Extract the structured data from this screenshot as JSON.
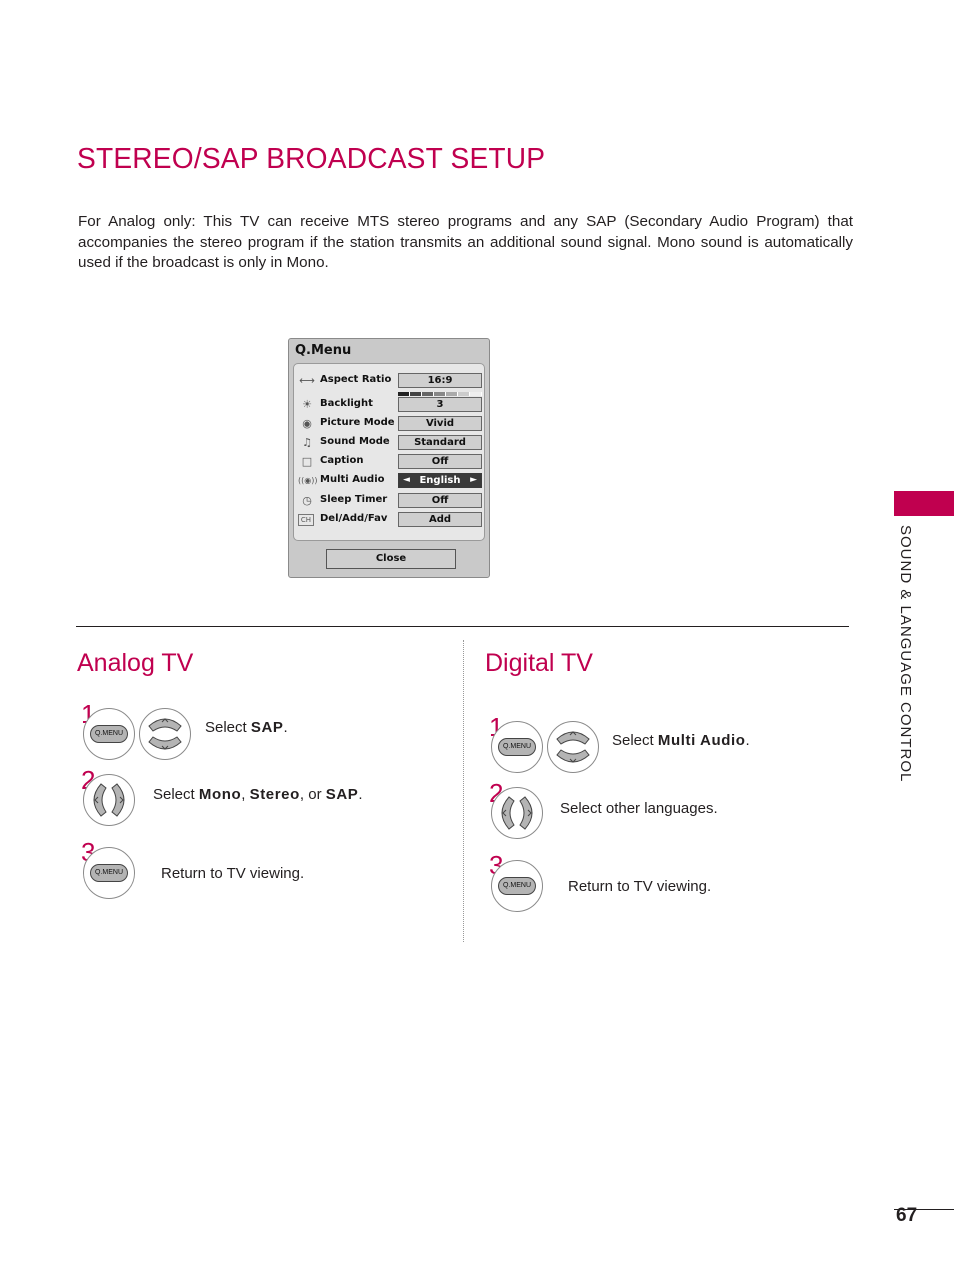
{
  "page": {
    "title": "STEREO/SAP BROADCAST SETUP",
    "intro": "For Analog only: This TV can receive MTS stereo programs and any SAP (Secondary Audio Program) that accompanies the stereo program if the station transmits an additional sound signal. Mono sound is automatically used if the broadcast is only in Mono.",
    "side_tab_label": "SOUND & LANGUAGE CONTROL",
    "page_number": "67",
    "accent_color": "#c0004f"
  },
  "qmenu": {
    "title": "Q.Menu",
    "items": [
      {
        "icon": "aspect-ratio-icon",
        "glyph": "⟷",
        "label": "Aspect Ratio",
        "value": "16:9"
      },
      {
        "icon": "backlight-icon",
        "glyph": "☀",
        "label": "Backlight",
        "value": "3",
        "level_fraction": 0.3
      },
      {
        "icon": "picture-mode-icon",
        "glyph": "◉",
        "label": "Picture Mode",
        "value": "Vivid"
      },
      {
        "icon": "sound-mode-icon",
        "glyph": "♫",
        "label": "Sound Mode",
        "value": "Standard"
      },
      {
        "icon": "caption-icon",
        "glyph": "□",
        "label": "Caption",
        "value": "Off"
      },
      {
        "icon": "multi-audio-icon",
        "glyph": "((◉))",
        "label": "Multi Audio",
        "value": "English",
        "selected": true
      },
      {
        "icon": "sleep-timer-icon",
        "glyph": "◷",
        "label": "Sleep Timer",
        "value": "Off"
      },
      {
        "icon": "channel-icon",
        "glyph": "CH",
        "label": "Del/Add/Fav",
        "value": "Add"
      }
    ],
    "left_arrow": "◄",
    "right_arrow": "►",
    "close_label": "Close"
  },
  "analog": {
    "heading": "Analog TV",
    "steps": [
      {
        "num": "1",
        "pre": "Select ",
        "bold": "SAP",
        "post": "."
      },
      {
        "num": "2",
        "pre": "Select ",
        "bold": "Mono",
        "mid": ", ",
        "bold2": "Stereo",
        "mid2": ", or ",
        "bold3": "SAP",
        "post": "."
      },
      {
        "num": "3",
        "text": "Return to TV viewing."
      }
    ]
  },
  "digital": {
    "heading": "Digital TV",
    "steps": [
      {
        "num": "1",
        "pre": "Select ",
        "bold": "Multi Audio",
        "post": "."
      },
      {
        "num": "2",
        "text": "Select other languages."
      },
      {
        "num": "3",
        "text": "Return to TV viewing."
      }
    ]
  },
  "remote": {
    "qmenu_label": "Q.MENU",
    "up": "^",
    "down": "v",
    "left": "<",
    "right": ">"
  }
}
